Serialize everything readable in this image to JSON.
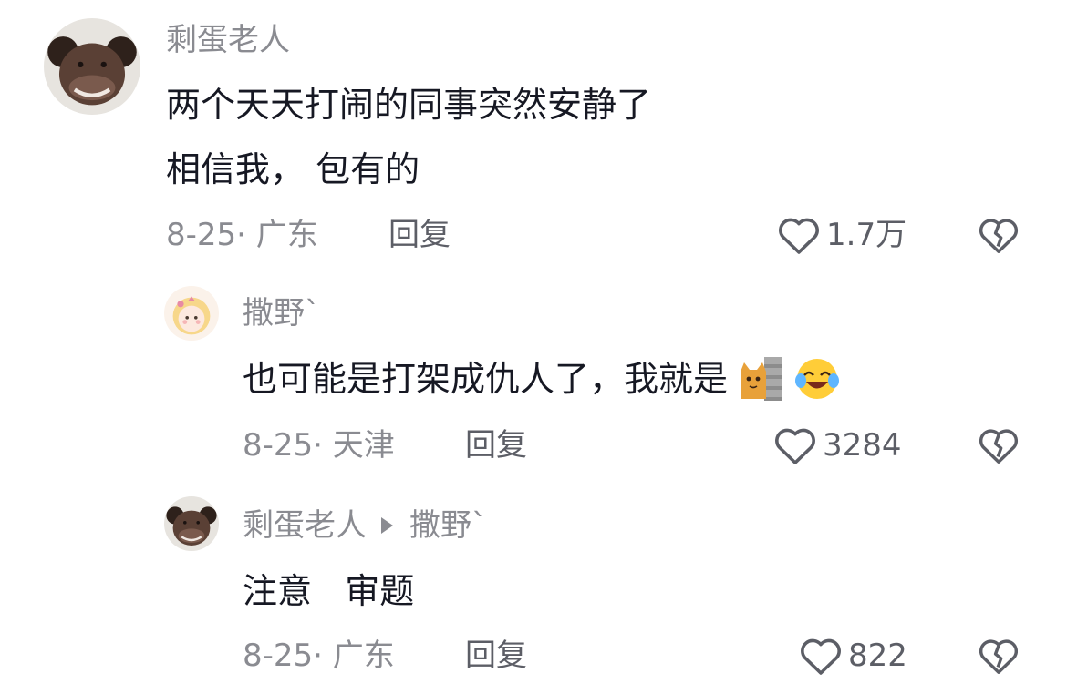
{
  "comments": [
    {
      "username": "剩蛋老人",
      "text_lines": [
        "两个天天打闹的同事突然安静了",
        "相信我， 包有的"
      ],
      "meta": "8-25· 广东",
      "reply_label": "回复",
      "likes": "1.7万"
    },
    {
      "username": "撒野`",
      "text_lines": [
        "也可能是打架成仇人了，我就是"
      ],
      "emojis": [
        "peeking-cat-wall-emoji",
        "crying-laughing-emoji"
      ],
      "meta": "8-25· 天津",
      "reply_label": "回复",
      "likes": "3284"
    },
    {
      "username": "剩蛋老人",
      "reply_to": "撒野`",
      "text_lines": [
        "注意   审题"
      ],
      "meta": "8-25· 广东",
      "reply_label": "回复",
      "likes": "822"
    }
  ],
  "colors": {
    "text": "#161823",
    "secondary": "#8a8b91",
    "action": "#5c5e66"
  },
  "icons": [
    "heart-outline-icon",
    "broken-heart-icon",
    "reply-arrow-icon"
  ]
}
